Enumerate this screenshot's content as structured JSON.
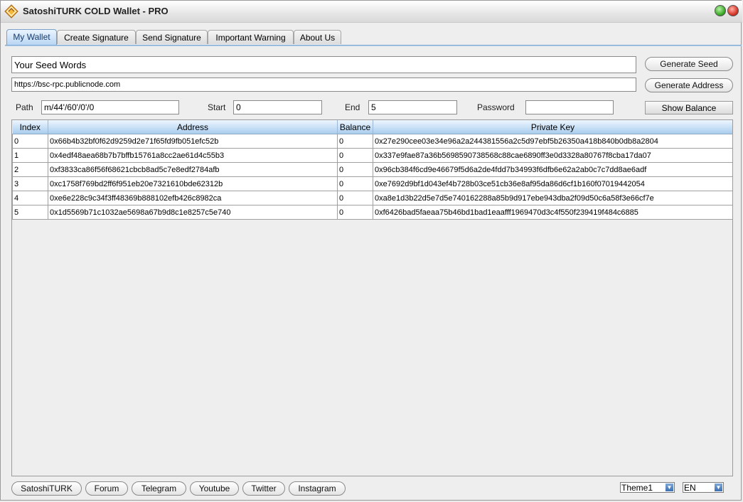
{
  "window": {
    "title": "SatoshiTURK COLD Wallet - PRO"
  },
  "tabs": [
    {
      "label": "My Wallet",
      "active": true
    },
    {
      "label": "Create Signature",
      "active": false
    },
    {
      "label": "Send Signature",
      "active": false
    },
    {
      "label": "Important Warning",
      "active": false
    },
    {
      "label": "About Us",
      "active": false
    }
  ],
  "wallet": {
    "seed_value": "Your Seed Words",
    "rpc_value": "https://bsc-rpc.publicnode.com",
    "generate_seed_label": "Generate Seed",
    "generate_address_label": "Generate Address",
    "path_label": "Path",
    "path_value": "m/44'/60'/0'/0",
    "start_label": "Start",
    "start_value": "0",
    "end_label": "End",
    "end_value": "5",
    "password_label": "Password",
    "password_value": "",
    "show_balance_label": "Show Balance"
  },
  "table": {
    "columns": [
      "Index",
      "Address",
      "Balance",
      "Private Key"
    ],
    "rows": [
      [
        "0",
        "0x66b4b32bf0f62d9259d2e71f65fd9fb051efc52b",
        "0",
        "0x27e290cee03e34e96a2a244381556a2c5d97ebf5b26350a418b840b0db8a2804"
      ],
      [
        "1",
        "0x4edf48aea68b7b7bffb15761a8cc2ae61d4c55b3",
        "0",
        "0x337e9fae87a36b5698590738568c88cae6890ff3e0d3328a80767f8cba17da07"
      ],
      [
        "2",
        "0xf3833ca86f56f68621cbcb8ad5c7e8edf2784afb",
        "0",
        "0x96cb384f6cd9e46679f5d6a2de4fdd7b34993f6dfb6e62a2ab0c7c7dd8ae6adf"
      ],
      [
        "3",
        "0xc1758f769bd2ff6f951eb20e7321610bde62312b",
        "0",
        "0xe7692d9bf1d043ef4b728b03ce51cb36e8af95da86d6cf1b160f07019442054"
      ],
      [
        "4",
        "0xe6e228c9c34f3ff48369b888102efb426c8982ca",
        "0",
        "0xa8e1d3b22d5e7d5e740162288a85b9d917ebe943dba2f09d50c6a58f3e66cf7e"
      ],
      [
        "5",
        "0x1d5569b71c1032ae5698a67b9d8c1e8257c5e740",
        "0",
        "0xf6426bad5faeaa75b46bd1bad1eaafff1969470d3c4f550f239419f484c6885"
      ]
    ]
  },
  "footer": {
    "links": [
      "SatoshiTURK",
      "Forum",
      "Telegram",
      "Youtube",
      "Twitter",
      "Instagram"
    ],
    "theme_value": "Theme1",
    "language_value": "EN"
  }
}
